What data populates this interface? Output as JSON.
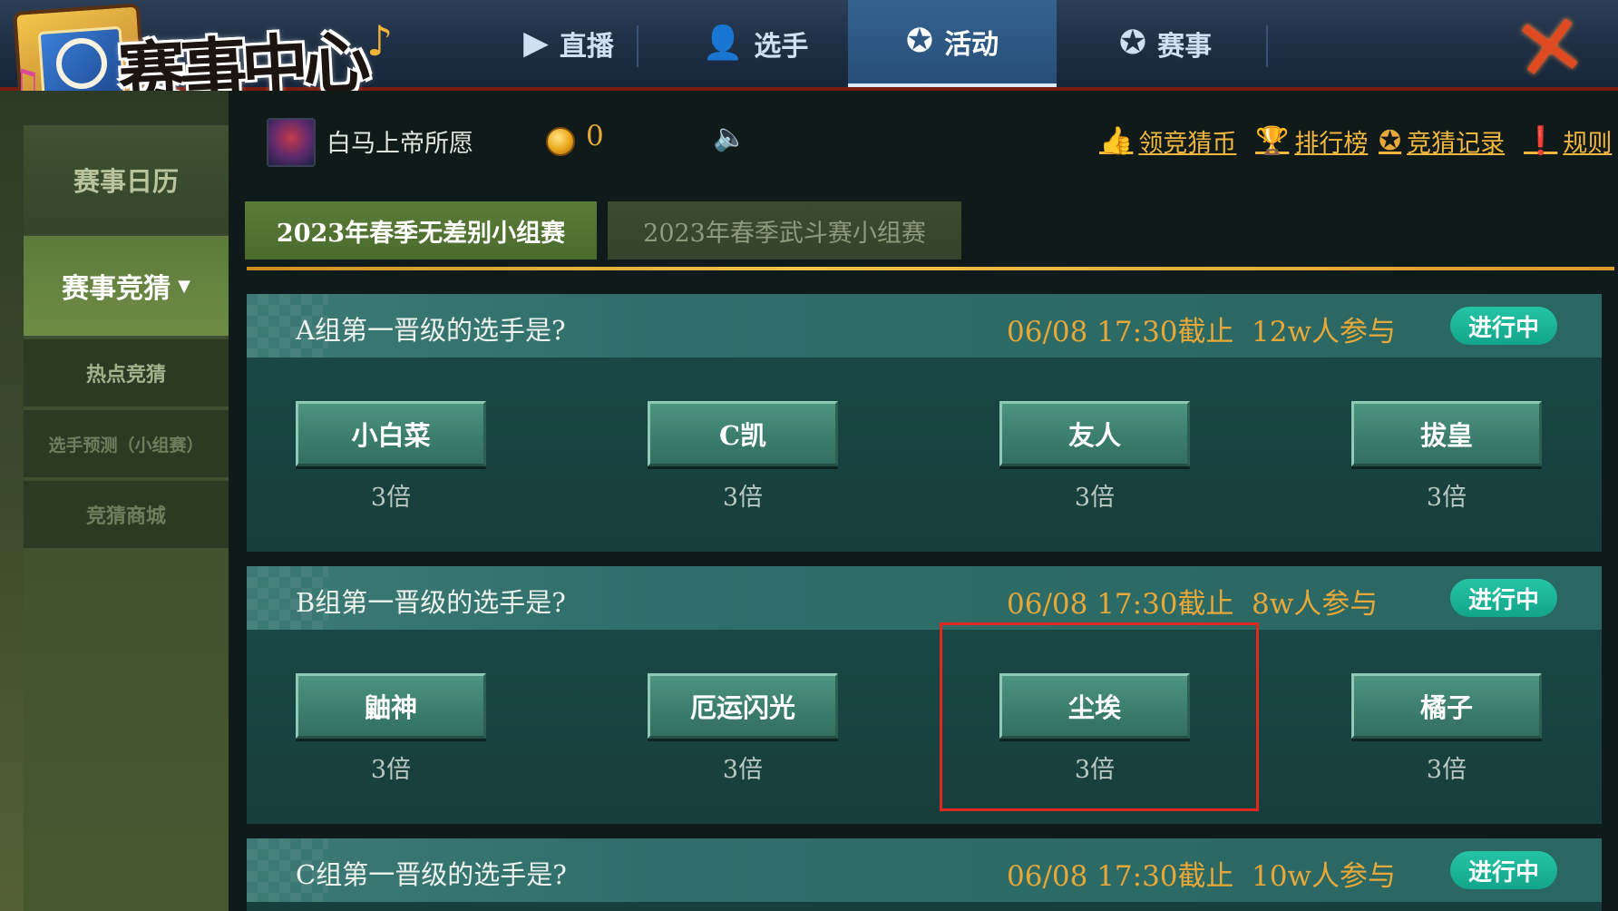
{
  "header": {
    "logo_text": "赛事中心",
    "nav_tabs": [
      {
        "label": "直播",
        "icon": "play-icon"
      },
      {
        "label": "选手",
        "icon": "players-icon"
      },
      {
        "label": "活动",
        "icon": "star-badge-icon",
        "active": true
      },
      {
        "label": "赛事",
        "icon": "star-badge-icon"
      }
    ],
    "close_icon": "close-icon"
  },
  "sidebar": {
    "calendar_label": "赛事日历",
    "guess_label": "赛事竞猜",
    "sub_items": [
      {
        "label": "热点竞猜"
      },
      {
        "label": "选手预测（小组赛）"
      },
      {
        "label": "竞猜商城"
      }
    ]
  },
  "user": {
    "name": "白马上帝所愿",
    "coins": "0",
    "links": [
      {
        "label": "领竞猜币",
        "icon": "thumbs-icon"
      },
      {
        "label": "排行榜",
        "icon": "trophy-icon"
      },
      {
        "label": "竞猜记录",
        "icon": "medal-icon"
      },
      {
        "label": "规则",
        "icon": "info-icon"
      }
    ]
  },
  "season_tabs": [
    {
      "label": "2023年春季无差别小组赛",
      "active": true
    },
    {
      "label": "2023年春季武斗赛小组赛",
      "active": false
    }
  ],
  "questions": [
    {
      "title": "A组第一晋级的选手是?",
      "deadline": "06/08  17:30截止",
      "participants": "12w人参与",
      "status": "进行中",
      "options": [
        {
          "name": "小白菜",
          "odds": "3倍"
        },
        {
          "name": "C凯",
          "odds": "3倍"
        },
        {
          "name": "友人",
          "odds": "3倍"
        },
        {
          "name": "拔皇",
          "odds": "3倍"
        }
      ]
    },
    {
      "title": "B组第一晋级的选手是?",
      "deadline": "06/08  17:30截止",
      "participants": "8w人参与",
      "status": "进行中",
      "options": [
        {
          "name": "鼬神",
          "odds": "3倍"
        },
        {
          "name": "厄运闪光",
          "odds": "3倍"
        },
        {
          "name": "尘埃",
          "odds": "3倍"
        },
        {
          "name": "橘子",
          "odds": "3倍"
        }
      ]
    },
    {
      "title": "C组第一晋级的选手是?",
      "deadline": "06/08  17:30截止",
      "participants": "10w人参与",
      "status": "进行中"
    }
  ],
  "colors": {
    "accent_gold": "#e7a83a",
    "status_green": "#1fb99b",
    "highlight_red": "#e02820"
  }
}
